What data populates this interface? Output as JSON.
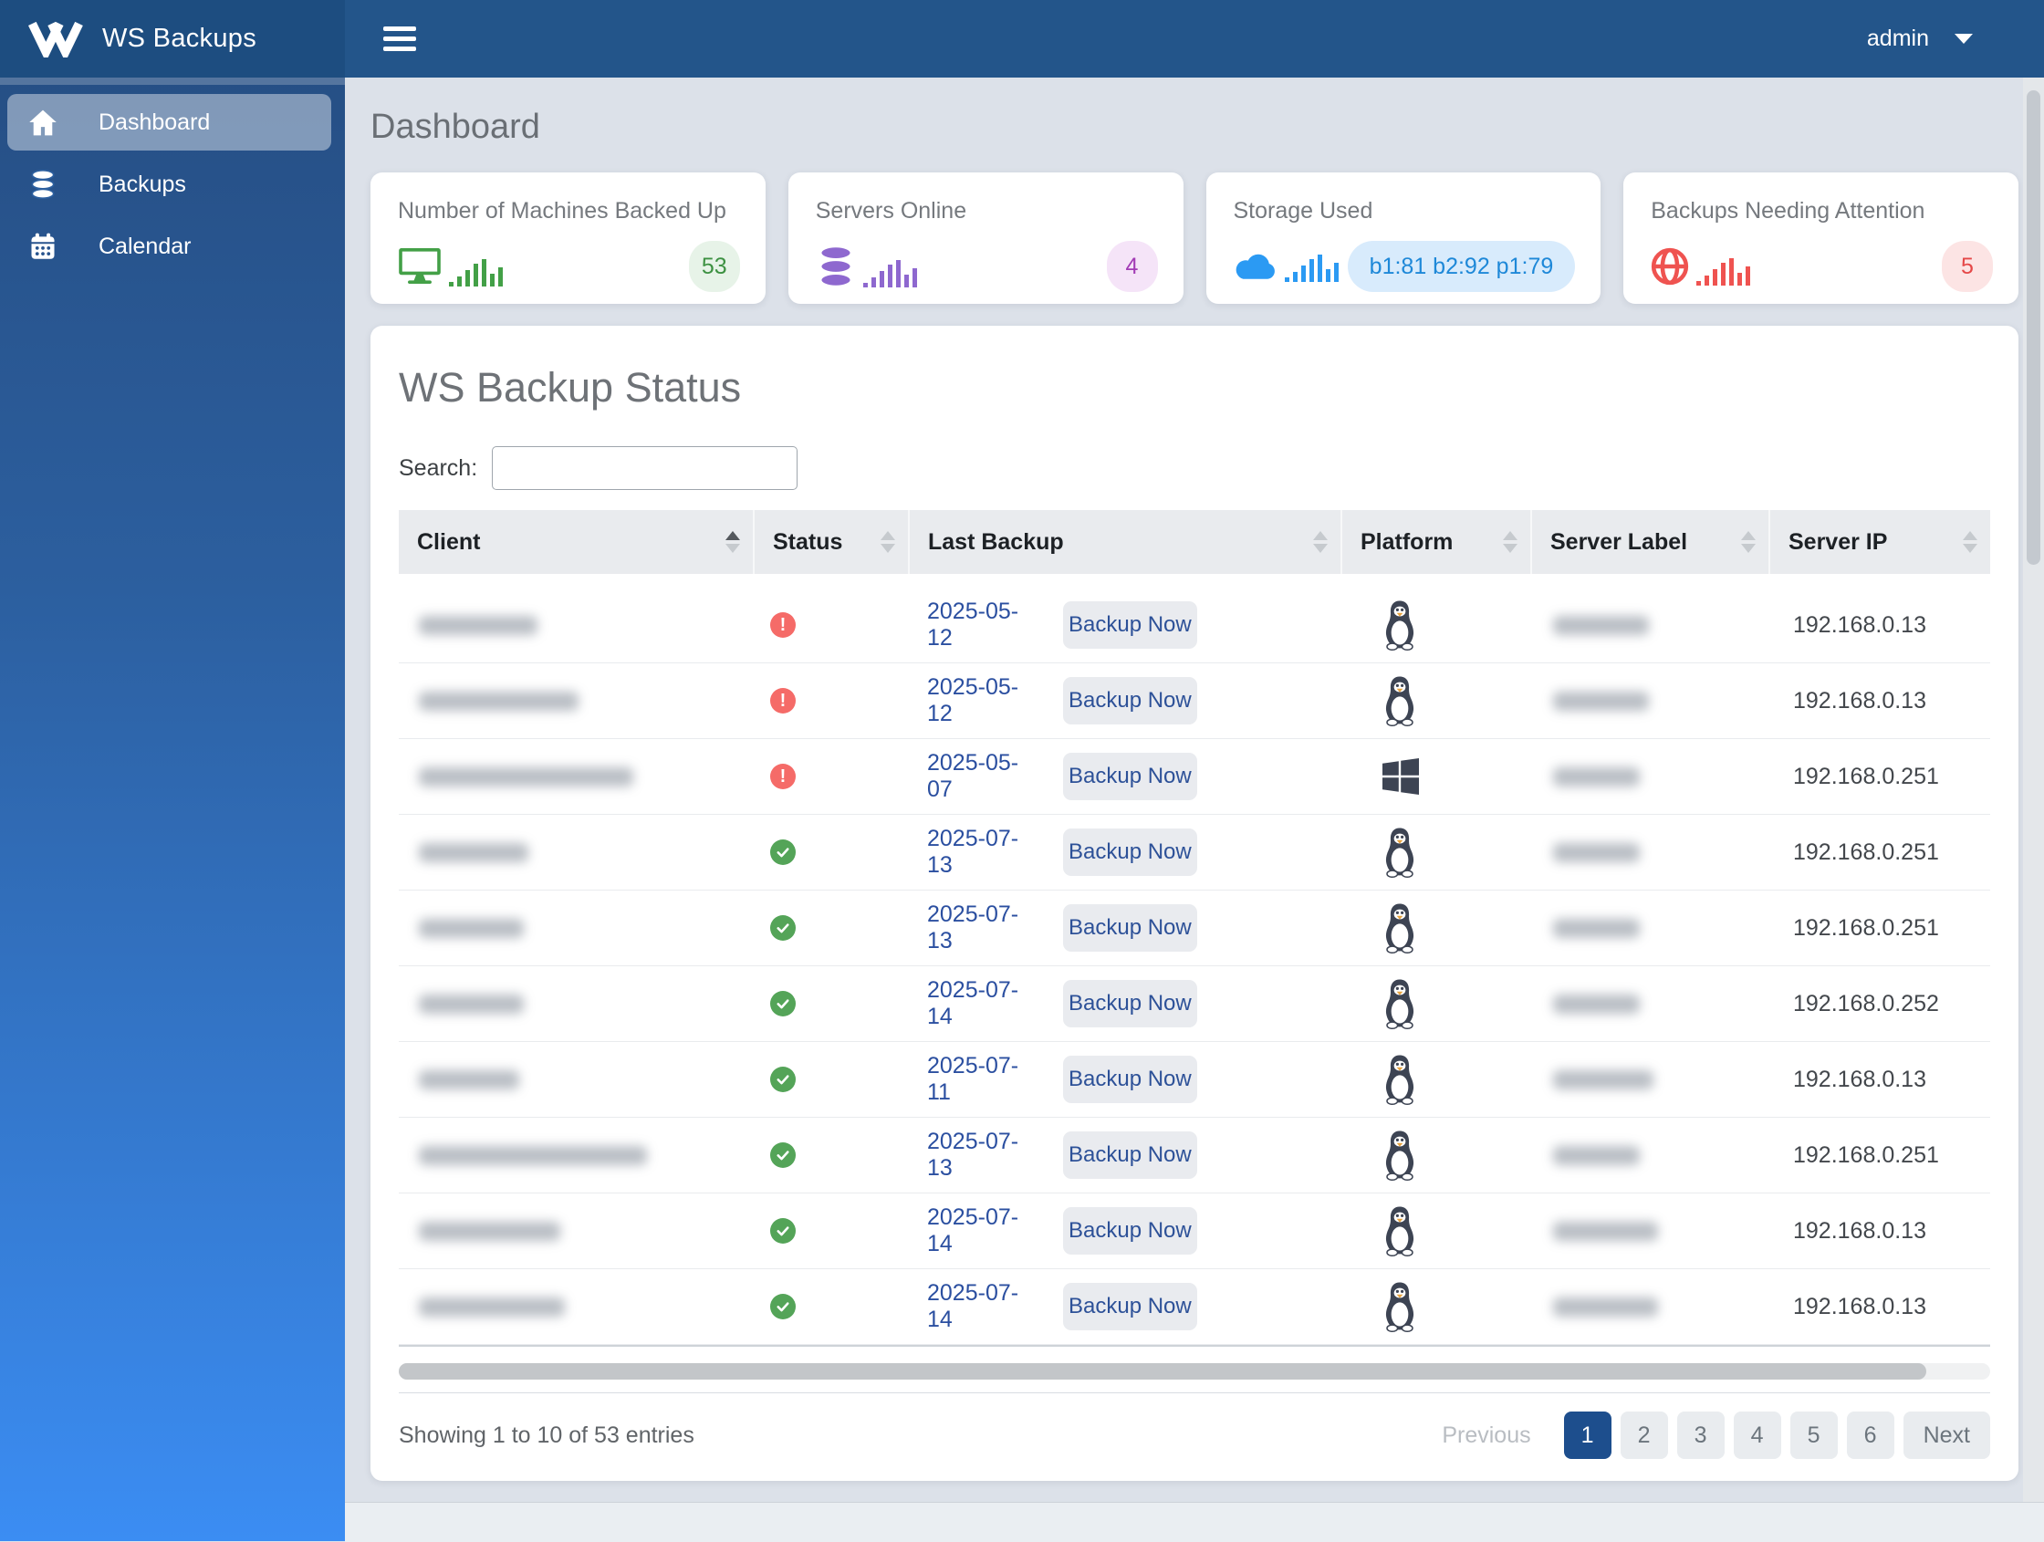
{
  "navbar": {
    "brand": "WS Backups",
    "user": "admin"
  },
  "sidebar": {
    "items": [
      {
        "label": "Dashboard",
        "icon": "home",
        "active": true
      },
      {
        "label": "Backups",
        "icon": "database",
        "active": false
      },
      {
        "label": "Calendar",
        "icon": "calendar",
        "active": false
      }
    ]
  },
  "page": {
    "title": "Dashboard"
  },
  "cards": [
    {
      "title": "Number of Machines Backed Up",
      "icon": "monitor-icon",
      "accent": "#43a047",
      "badge": "53",
      "badge_bg": "#e7f3e8",
      "badge_color": "#3d9142"
    },
    {
      "title": "Servers Online",
      "icon": "database-icon",
      "accent": "#8e68cf",
      "badge": "4",
      "badge_bg": "#f5e4f8",
      "badge_color": "#a23bb5"
    },
    {
      "title": "Storage Used",
      "icon": "cloud-icon",
      "accent": "#2b9af3",
      "badge": "b1:81 b2:92 p1:79",
      "badge_bg": "#d8ebfc",
      "badge_color": "#1e88d8",
      "pill": true
    },
    {
      "title": "Backups Needing Attention",
      "icon": "globe-icon",
      "accent": "#ef5350",
      "badge": "5",
      "badge_bg": "#fce4e4",
      "badge_color": "#e54848"
    }
  ],
  "status_panel": {
    "title": "WS Backup Status",
    "search_label": "Search:",
    "search_value": "",
    "columns": [
      "Client",
      "Status",
      "Last Backup",
      "Platform",
      "Server Label",
      "Server IP"
    ],
    "sorted_column": "Client",
    "sort_direction": "asc",
    "action_label": "Backup Now",
    "status_colors": {
      "error": "#f56b68",
      "ok": "#54a458"
    },
    "rows": [
      {
        "client_redacted": true,
        "client_blur_width": 130,
        "status": "error",
        "last_backup": "2025-05-12",
        "platform": "linux",
        "label_redacted": true,
        "label_blur_width": 105,
        "server_ip": "192.168.0.13"
      },
      {
        "client_redacted": true,
        "client_blur_width": 175,
        "status": "error",
        "last_backup": "2025-05-12",
        "platform": "linux",
        "label_redacted": true,
        "label_blur_width": 105,
        "server_ip": "192.168.0.13"
      },
      {
        "client_redacted": true,
        "client_blur_width": 235,
        "status": "error",
        "last_backup": "2025-05-07",
        "platform": "windows",
        "label_redacted": true,
        "label_blur_width": 95,
        "server_ip": "192.168.0.251"
      },
      {
        "client_redacted": true,
        "client_blur_width": 120,
        "status": "ok",
        "last_backup": "2025-07-13",
        "platform": "linux",
        "label_redacted": true,
        "label_blur_width": 95,
        "server_ip": "192.168.0.251"
      },
      {
        "client_redacted": true,
        "client_blur_width": 115,
        "status": "ok",
        "last_backup": "2025-07-13",
        "platform": "linux",
        "label_redacted": true,
        "label_blur_width": 95,
        "server_ip": "192.168.0.251"
      },
      {
        "client_redacted": true,
        "client_blur_width": 115,
        "status": "ok",
        "last_backup": "2025-07-14",
        "platform": "linux",
        "label_redacted": true,
        "label_blur_width": 95,
        "server_ip": "192.168.0.252"
      },
      {
        "client_redacted": true,
        "client_blur_width": 110,
        "status": "ok",
        "last_backup": "2025-07-11",
        "platform": "linux",
        "label_redacted": true,
        "label_blur_width": 110,
        "server_ip": "192.168.0.13"
      },
      {
        "client_redacted": true,
        "client_blur_width": 250,
        "status": "ok",
        "last_backup": "2025-07-13",
        "platform": "linux",
        "label_redacted": true,
        "label_blur_width": 95,
        "server_ip": "192.168.0.251"
      },
      {
        "client_redacted": true,
        "client_blur_width": 155,
        "status": "ok",
        "last_backup": "2025-07-14",
        "platform": "linux",
        "label_redacted": true,
        "label_blur_width": 115,
        "server_ip": "192.168.0.13"
      },
      {
        "client_redacted": true,
        "client_blur_width": 160,
        "status": "ok",
        "last_backup": "2025-07-14",
        "platform": "linux",
        "label_redacted": true,
        "label_blur_width": 115,
        "server_ip": "192.168.0.13"
      }
    ],
    "footer": {
      "summary": "Showing 1 to 10 of 53 entries",
      "previous_label": "Previous",
      "pages": [
        "1",
        "2",
        "3",
        "4",
        "5",
        "6"
      ],
      "active_page": "1",
      "next_label": "Next"
    }
  }
}
